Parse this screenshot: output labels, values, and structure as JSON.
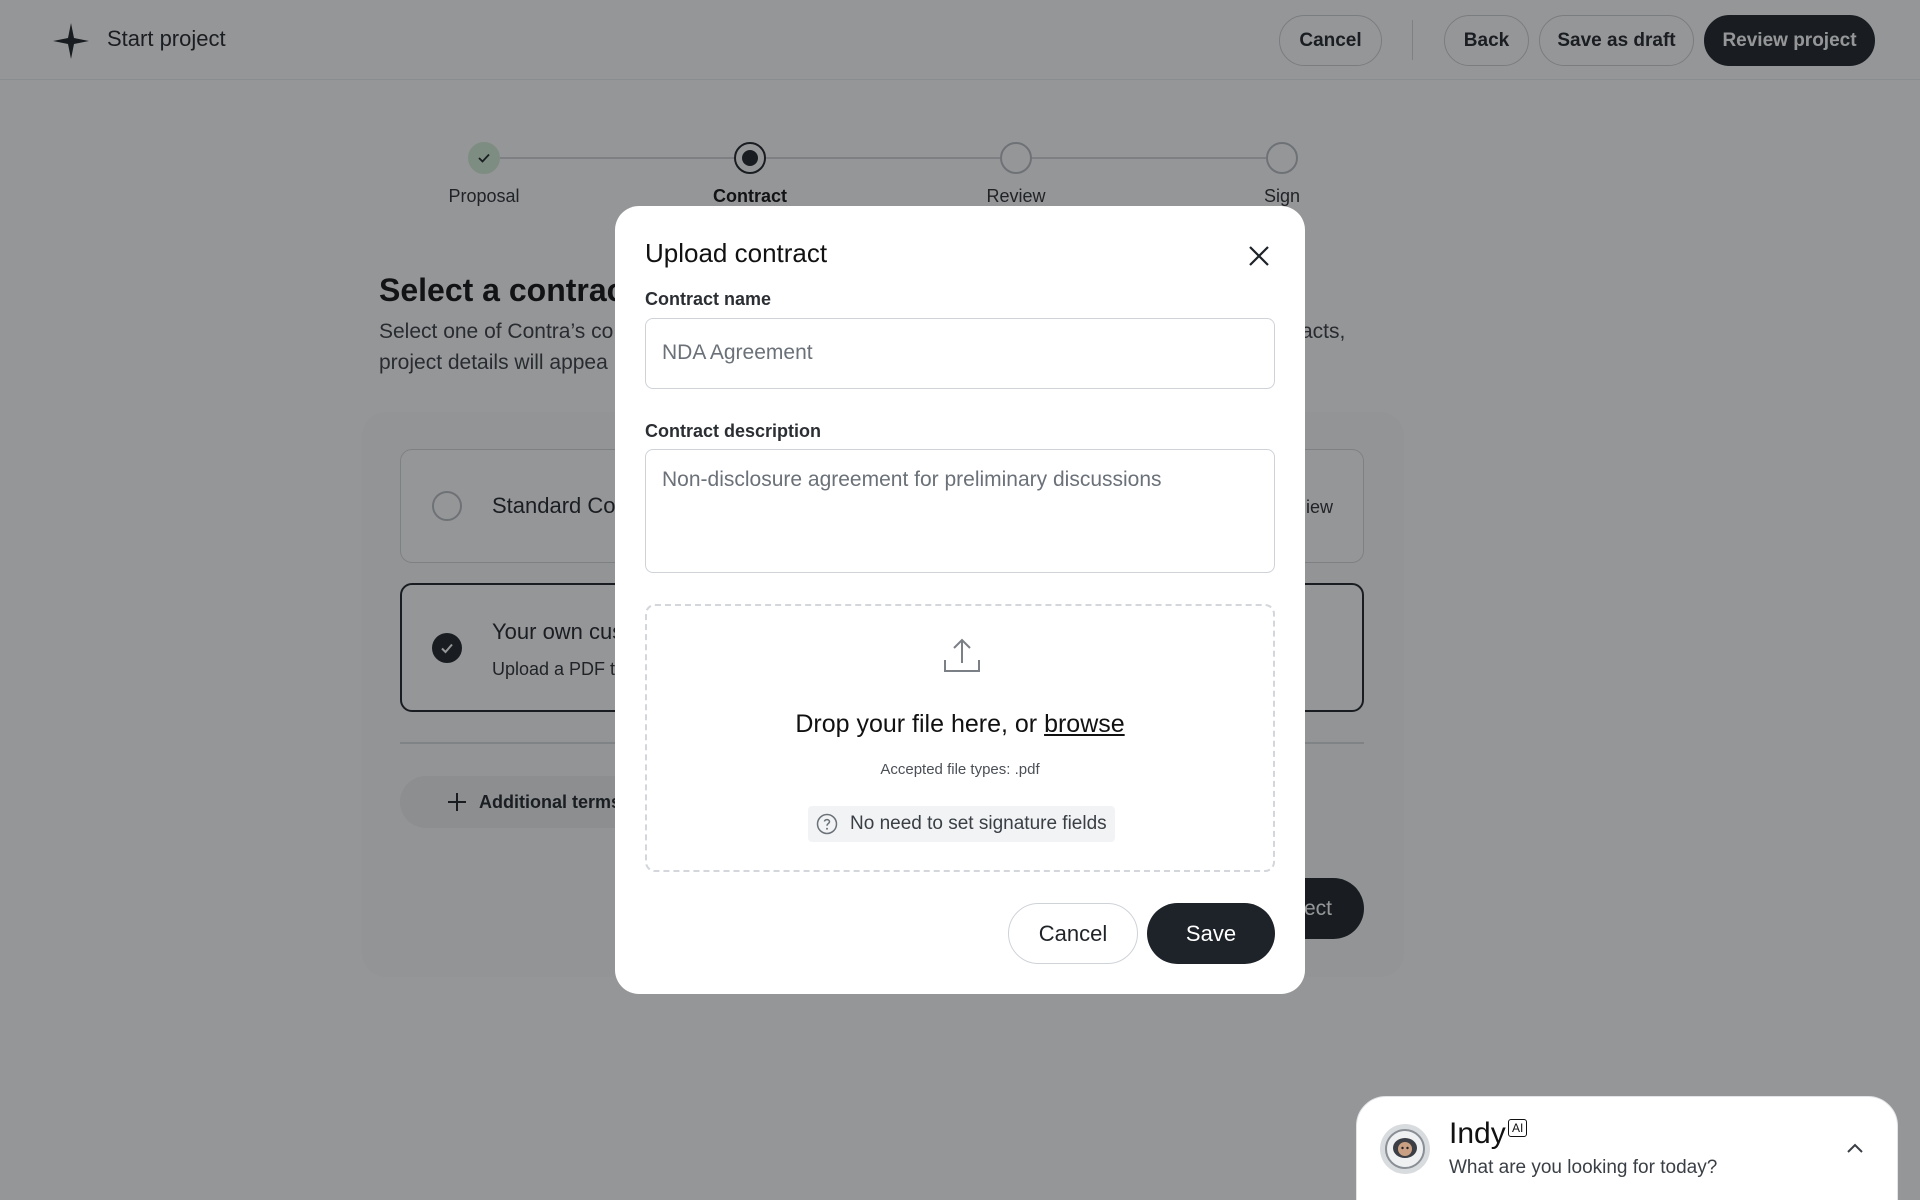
{
  "header": {
    "title": "Start project",
    "cancel_label": "Cancel",
    "back_label": "Back",
    "save_draft_label": "Save as draft",
    "review_label": "Review project"
  },
  "stepper": {
    "steps": [
      {
        "label": "Proposal",
        "state": "done"
      },
      {
        "label": "Contract",
        "state": "current"
      },
      {
        "label": "Review",
        "state": "upcoming"
      },
      {
        "label": "Sign",
        "state": "upcoming"
      }
    ]
  },
  "main": {
    "title": "Select a contract",
    "description_line1_start": "Select one of Contra’s co",
    "description_line1_end": "racts,",
    "description_line2": "project details will appea",
    "options": [
      {
        "title": "Standard Con",
        "link": "iew",
        "selected": false
      },
      {
        "title": "Your own cus",
        "subtitle": "Upload a PDF t",
        "selected": true
      }
    ],
    "additional_terms_label": "Additional terms",
    "behind_button_label": "ect"
  },
  "modal": {
    "title": "Upload contract",
    "name_label": "Contract name",
    "name_placeholder": "NDA Agreement",
    "desc_label": "Contract description",
    "desc_placeholder": "Non-disclosure agreement for preliminary discussions",
    "drop_text": "Drop your file here, or",
    "browse_label": "browse",
    "accepted_types": "Accepted file types: .pdf",
    "hint": "No need to set signature fields",
    "cancel_label": "Cancel",
    "save_label": "Save"
  },
  "chat": {
    "name": "Indy",
    "badge": "AI",
    "prompt": "What are you looking for today?"
  },
  "colors": {
    "primary_dark": "#1e2329",
    "done_green": "#d6efd9",
    "overlay": "rgba(20,22,24,0.45)"
  },
  "icons": [
    "contra-star-logo",
    "check-icon",
    "plus-icon",
    "close-icon",
    "upload-icon",
    "question-circle-icon",
    "avatar-astronaut",
    "chevron-up-icon"
  ]
}
